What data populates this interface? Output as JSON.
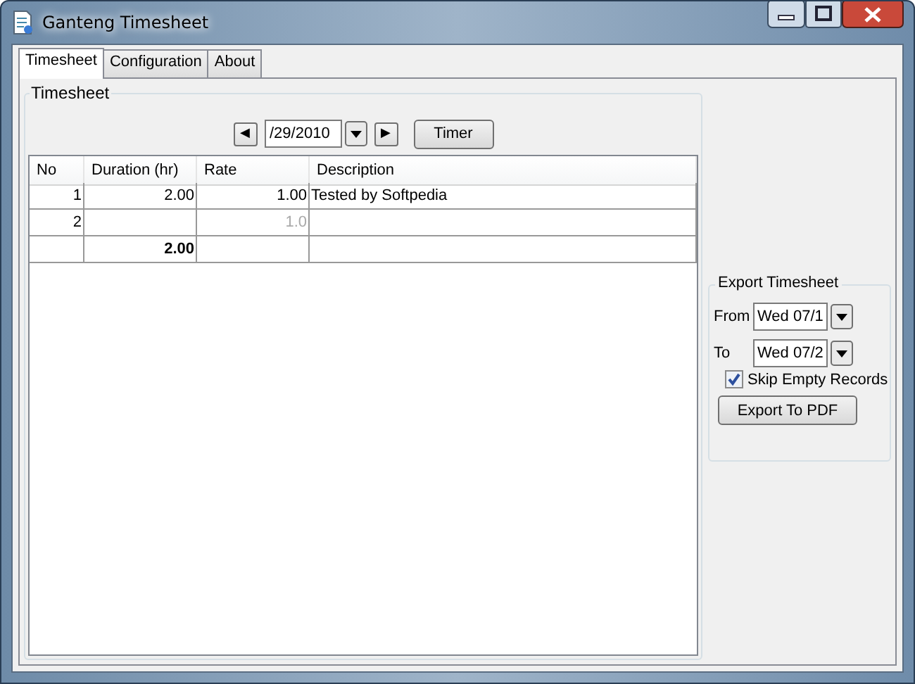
{
  "window": {
    "title": "Ganteng Timesheet"
  },
  "tabs": [
    {
      "label": "Timesheet",
      "selected": true
    },
    {
      "label": "Configuration",
      "selected": false
    },
    {
      "label": "About",
      "selected": false
    }
  ],
  "timesheet": {
    "title": "Timesheet",
    "prev_button": "◀",
    "date": "/29/2010",
    "next_button": "▶",
    "timer_button": "Timer",
    "table": {
      "columns": [
        "No",
        "Duration (hr)",
        "Rate",
        "Description"
      ],
      "rows": [
        {
          "no": "1",
          "duration": "2.00",
          "rate": "1.00",
          "description": "Tested by Softpedia"
        }
      ],
      "new_row": {
        "no": "2",
        "rate_placeholder": "1.0"
      },
      "total": {
        "duration": "2.00"
      }
    }
  },
  "export": {
    "title": "Export Timesheet",
    "from_label": "From",
    "from_value": "Wed 07/1",
    "to_label": "To",
    "to_value": "Wed 07/2",
    "skip_empty": {
      "label": "Skip Empty Records",
      "checked": true
    },
    "export_button": "Export To PDF"
  }
}
